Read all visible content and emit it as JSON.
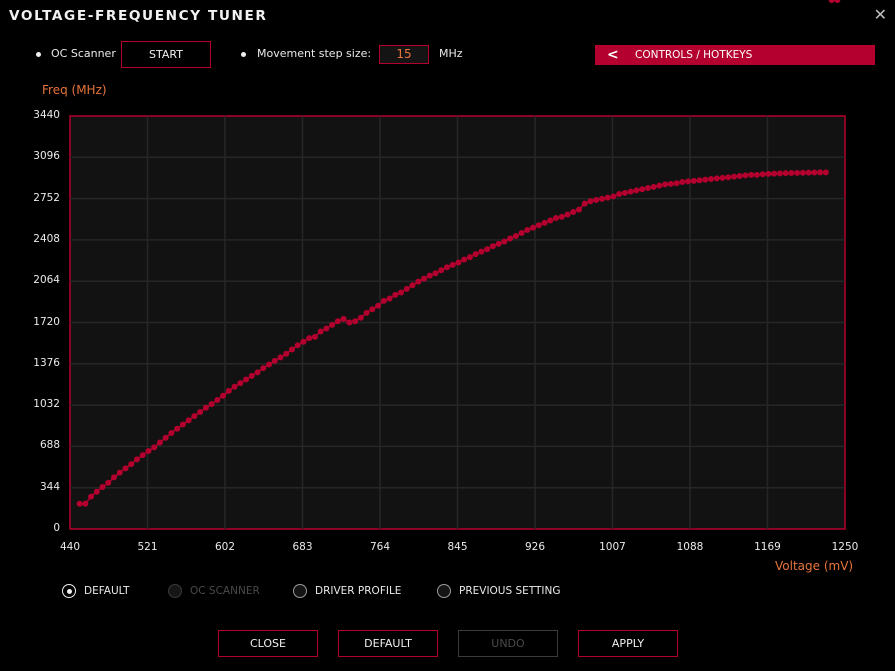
{
  "window": {
    "title": "VOLTAGE-FREQUENCY TUNER",
    "close_icon": "close-icon"
  },
  "toolbar": {
    "oc_scanner_label": "OC Scanner",
    "start_label": "START",
    "step_label": "Movement step size:",
    "step_value": "15",
    "step_unit": "MHz",
    "controls_label": "CONTROLS / HOTKEYS",
    "controls_icon": "chevron-left-icon"
  },
  "colors": {
    "accent": "#b4002e",
    "axis_title": "#e8743b",
    "plot_bg": "#121212",
    "grid": "#262626"
  },
  "chart_data": {
    "type": "line",
    "title": "",
    "xlabel": "Voltage (mV)",
    "ylabel": "Freq (MHz)",
    "xlim": [
      440,
      1250
    ],
    "ylim": [
      0,
      3440
    ],
    "xticks": [
      "440",
      "521",
      "602",
      "683",
      "764",
      "845",
      "926",
      "1007",
      "1088",
      "1169",
      "1250"
    ],
    "yticks": [
      "3440",
      "3096",
      "2752",
      "2408",
      "2064",
      "1720",
      "1376",
      "1032",
      "688",
      "344",
      "0"
    ],
    "grid": true,
    "series": [
      {
        "name": "V/F curve",
        "x": [
          450,
          456,
          462,
          468,
          474,
          480,
          486,
          492,
          498,
          504,
          510,
          516,
          522,
          528,
          534,
          540,
          546,
          552,
          558,
          564,
          570,
          576,
          582,
          588,
          594,
          600,
          606,
          612,
          618,
          624,
          630,
          636,
          642,
          648,
          654,
          660,
          666,
          672,
          678,
          684,
          690,
          696,
          702,
          708,
          714,
          720,
          726,
          732,
          738,
          744,
          750,
          756,
          762,
          768,
          774,
          780,
          786,
          792,
          798,
          804,
          810,
          816,
          822,
          828,
          834,
          840,
          846,
          852,
          858,
          864,
          870,
          876,
          882,
          888,
          894,
          900,
          906,
          912,
          918,
          924,
          930,
          936,
          942,
          948,
          954,
          960,
          966,
          972,
          978,
          984,
          990,
          996,
          1002,
          1008,
          1014,
          1020,
          1026,
          1032,
          1038,
          1044,
          1050,
          1056,
          1062,
          1068,
          1074,
          1080,
          1086,
          1092,
          1098,
          1104,
          1110,
          1116,
          1122,
          1128,
          1134,
          1140,
          1146,
          1152,
          1158,
          1164,
          1170,
          1176,
          1182,
          1188,
          1194,
          1200,
          1206,
          1212,
          1218,
          1224,
          1230,
          1236,
          1242
        ],
        "y": [
          210,
          210,
          270,
          310,
          350,
          385,
          430,
          470,
          505,
          540,
          580,
          615,
          650,
          680,
          720,
          760,
          800,
          835,
          870,
          905,
          940,
          975,
          1010,
          1040,
          1075,
          1110,
          1150,
          1185,
          1215,
          1245,
          1275,
          1305,
          1340,
          1370,
          1400,
          1430,
          1460,
          1495,
          1530,
          1560,
          1590,
          1600,
          1645,
          1670,
          1700,
          1730,
          1750,
          1720,
          1730,
          1760,
          1800,
          1830,
          1860,
          1900,
          1920,
          1950,
          1970,
          2000,
          2030,
          2060,
          2085,
          2110,
          2130,
          2155,
          2180,
          2200,
          2220,
          2245,
          2265,
          2290,
          2310,
          2330,
          2355,
          2375,
          2395,
          2420,
          2440,
          2465,
          2490,
          2510,
          2530,
          2550,
          2570,
          2590,
          2600,
          2620,
          2640,
          2660,
          2710,
          2730,
          2740,
          2750,
          2760,
          2770,
          2790,
          2800,
          2810,
          2820,
          2830,
          2840,
          2850,
          2860,
          2870,
          2875,
          2880,
          2890,
          2895,
          2900,
          2905,
          2910,
          2915,
          2920,
          2925,
          2930,
          2935,
          2940,
          2945,
          2950,
          2950,
          2955,
          2958,
          2960,
          2962,
          2964,
          2965,
          2966,
          2967,
          2968,
          2969,
          2970,
          2970
        ]
      }
    ]
  },
  "profiles": [
    {
      "label": "DEFAULT",
      "checked": true,
      "disabled": false
    },
    {
      "label": "OC SCANNER",
      "checked": false,
      "disabled": true
    },
    {
      "label": "DRIVER PROFILE",
      "checked": false,
      "disabled": false
    },
    {
      "label": "PREVIOUS SETTING",
      "checked": false,
      "disabled": false
    }
  ],
  "footer": {
    "close": "CLOSE",
    "default": "DEFAULT",
    "undo": "UNDO",
    "apply": "APPLY"
  }
}
